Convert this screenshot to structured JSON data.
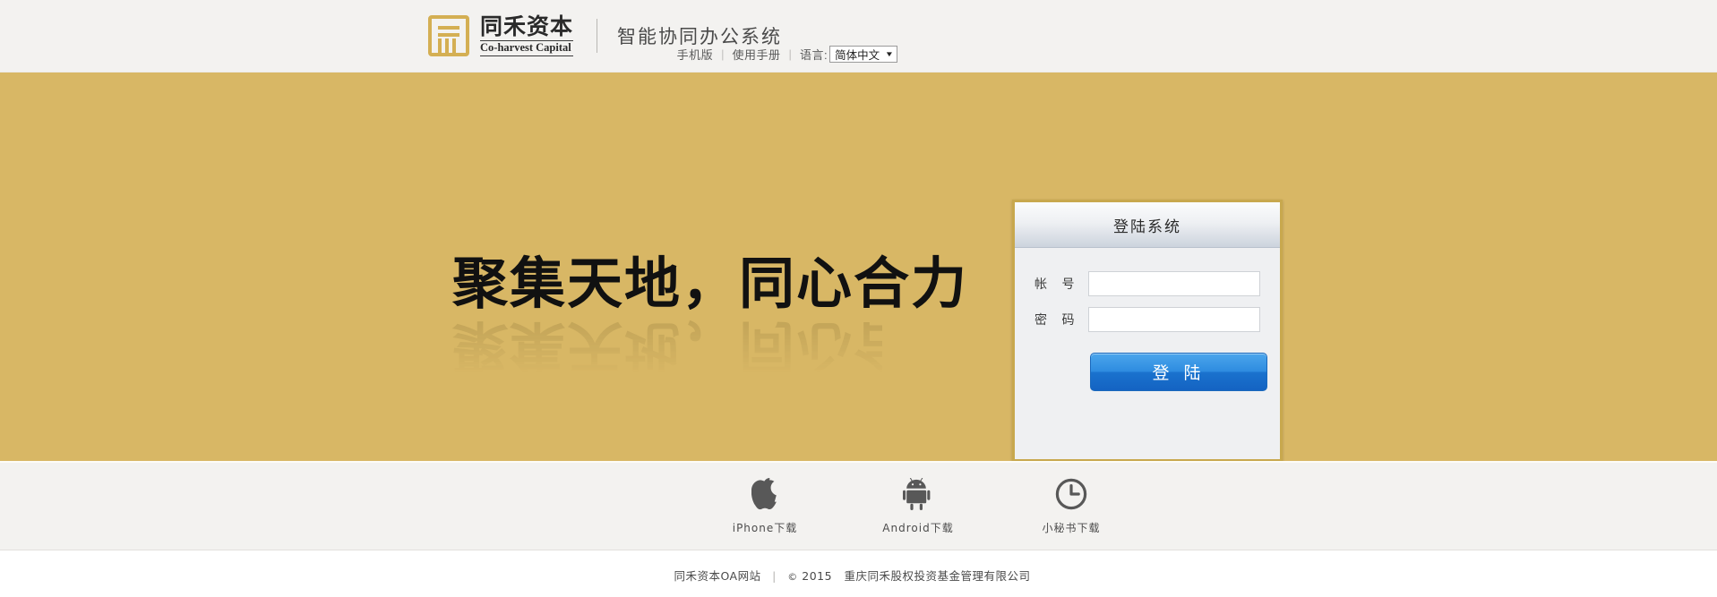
{
  "header": {
    "brand_cn": "同禾资本",
    "brand_en": "Co-harvest Capital",
    "system_title": "智能协同办公系统",
    "logo_icon": "co-harvest-seal-icon",
    "nav": {
      "mobile_version": "手机版",
      "user_manual": "使用手册",
      "separator": "|",
      "language_label": "语言:",
      "language_selected": "简体中文",
      "caret_glyph": "▼"
    }
  },
  "hero": {
    "slogan": "聚集天地，同心合力",
    "background_color": "#d8b765"
  },
  "login": {
    "panel_title": "登陆系统",
    "border_color": "#c8a84e",
    "fields": {
      "account_label": "帐 号",
      "account_value": "",
      "account_placeholder": "",
      "password_label": "密 码",
      "password_value": "",
      "password_placeholder": ""
    },
    "submit_label": "登 陆",
    "submit_color": "#1f7ad4"
  },
  "downloads": [
    {
      "label": "iPhone下载",
      "icon": "apple-icon"
    },
    {
      "label": "Android下载",
      "icon": "android-icon"
    },
    {
      "label": "小秘书下载",
      "icon": "clock-icon"
    }
  ],
  "footer": {
    "site_name": "同禾资本OA网站",
    "separator": "|",
    "copyright_mark": "©",
    "year": "2015",
    "company": "重庆同禾股权投资基金管理有限公司"
  }
}
